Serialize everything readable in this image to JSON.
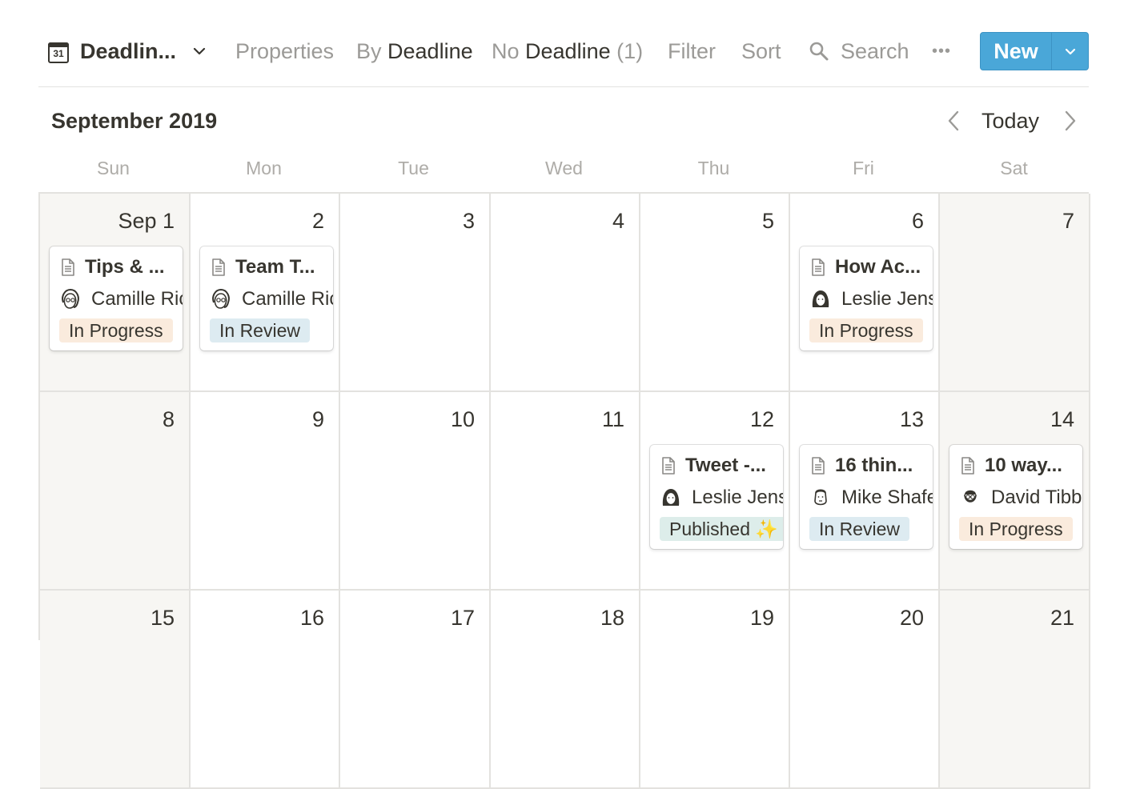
{
  "toolbar": {
    "calendar_icon_day": "31",
    "view_name": "Deadlin...",
    "properties": "Properties",
    "by_prefix": "By",
    "by_value": "Deadline",
    "no_prefix": "No",
    "no_value": "Deadline",
    "no_count": "(1)",
    "filter": "Filter",
    "sort": "Sort",
    "search": "Search",
    "more": "•••",
    "new_label": "New"
  },
  "month_title": "September 2019",
  "today_label": "Today",
  "weekdays": [
    "Sun",
    "Mon",
    "Tue",
    "Wed",
    "Thu",
    "Fri",
    "Sat"
  ],
  "weeks": [
    [
      "Sep 1",
      "2",
      "3",
      "4",
      "5",
      "6",
      "7"
    ],
    [
      "8",
      "9",
      "10",
      "11",
      "12",
      "13",
      "14"
    ],
    [
      "15",
      "16",
      "17",
      "18",
      "19",
      "20",
      "21"
    ]
  ],
  "cards": [
    {
      "title": "Tips & ...",
      "person": "Camille Ricketts",
      "status": "In Progress",
      "status_kind": "progress",
      "avatar": "camille-avatar"
    },
    {
      "title": "Team T...",
      "person": "Camille Ricketts",
      "status": "In Review",
      "status_kind": "review",
      "avatar": "camille-avatar"
    },
    {
      "title": "How Ac...",
      "person": "Leslie Jensen",
      "status": "In Progress",
      "status_kind": "progress",
      "avatar": "leslie-avatar"
    },
    {
      "title": "Tweet -...",
      "person": "Leslie Jensen",
      "status": "Published ✨",
      "status_kind": "published",
      "avatar": "leslie-avatar"
    },
    {
      "title": "16 thin...",
      "person": "Mike Shafer",
      "status": "In Review",
      "status_kind": "review",
      "avatar": "mike-avatar"
    },
    {
      "title": "10 way...",
      "person": "David Tibbitts",
      "status": "In Progress",
      "status_kind": "progress",
      "avatar": "david-avatar"
    }
  ],
  "colors": {
    "accent": "#4aa7d8",
    "tag_in_progress": "#faebdd",
    "tag_in_review": "#ddebf1",
    "tag_published": "#ddedea",
    "weekend_bg": "#f7f6f3"
  }
}
